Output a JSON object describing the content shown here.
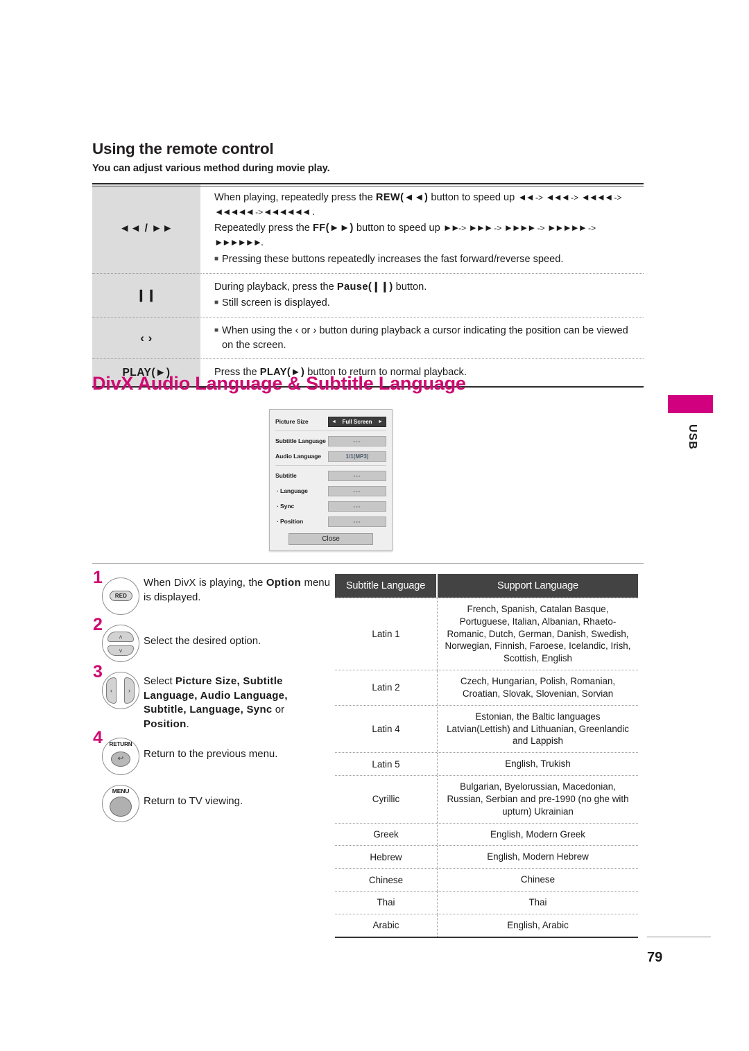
{
  "section": {
    "title": "Using the remote control",
    "subtitle": "You can adjust various method during movie play."
  },
  "remote_table": {
    "rows": [
      {
        "key": "◄◄ / ►►",
        "lines": [
          {
            "type": "text",
            "parts": [
              {
                "t": "When playing, repeatedly press the "
              },
              {
                "t": "REW(◄◄)",
                "bold": true
              },
              {
                "t": " button to speed up "
              },
              {
                "t": "◄◄",
                "arrows": true
              },
              {
                "t": " -> "
              },
              {
                "t": "◄◄◄",
                "arrows": true
              },
              {
                "t": " -> "
              },
              {
                "t": "◄◄◄◄",
                "arrows": true
              },
              {
                "t": " -> "
              },
              {
                "t": "◄◄◄◄◄",
                "arrows": true
              },
              {
                "t": " ->"
              },
              {
                "t": "◄◄◄◄◄◄",
                "arrows": true
              },
              {
                "t": " ."
              }
            ]
          },
          {
            "type": "text",
            "parts": [
              {
                "t": "Repeatedly press the "
              },
              {
                "t": "FF(►►)",
                "bold": true
              },
              {
                "t": " button to speed up "
              },
              {
                "t": "►►",
                "arrows": true
              },
              {
                "t": "-> "
              },
              {
                "t": "►►►",
                "arrows": true
              },
              {
                "t": " -> "
              },
              {
                "t": "►►►►",
                "arrows": true
              },
              {
                "t": " -> "
              },
              {
                "t": "►►►►►",
                "arrows": true
              },
              {
                "t": " -> "
              },
              {
                "t": "►►►►►►",
                "arrows": true
              },
              {
                "t": "."
              }
            ]
          },
          {
            "type": "bullet",
            "parts": [
              {
                "t": "Pressing these buttons repeatedly increases the fast forward/reverse speed."
              }
            ]
          }
        ]
      },
      {
        "key": "❙❙",
        "lines": [
          {
            "type": "text",
            "parts": [
              {
                "t": "During playback, press the "
              },
              {
                "t": "Pause(❙❙)",
                "bold": true
              },
              {
                "t": " button."
              }
            ]
          },
          {
            "type": "bullet",
            "parts": [
              {
                "t": "Still screen is displayed."
              }
            ]
          }
        ]
      },
      {
        "key": "‹  ›",
        "lines": [
          {
            "type": "bullet",
            "parts": [
              {
                "t": "When using the  ‹ or ›  button during playback a cursor indicating the position can be viewed on the screen."
              }
            ]
          }
        ]
      },
      {
        "key": "PLAY(►)",
        "lines": [
          {
            "type": "text",
            "parts": [
              {
                "t": "Press the "
              },
              {
                "t": "PLAY(►)",
                "bold": true
              },
              {
                "t": " button to return to normal playback."
              }
            ]
          }
        ]
      }
    ]
  },
  "divx_heading": "DivX Audio Language & Subtitle Language",
  "osd": {
    "rows": [
      {
        "label": "Picture Size",
        "value": "Full Screen",
        "style": "active",
        "indent": false
      },
      {
        "label": "Subtitle Language",
        "value": "---",
        "style": "dash",
        "indent": false
      },
      {
        "label": "Audio Language",
        "value": "1/1(MP3)",
        "style": "plain",
        "indent": false
      },
      {
        "label": "Subtitle",
        "value": "---",
        "style": "dash",
        "indent": false
      },
      {
        "label": "· Language",
        "value": "---",
        "style": "dash",
        "indent": true
      },
      {
        "label": "· Sync",
        "value": "---",
        "style": "dash",
        "indent": true
      },
      {
        "label": "· Position",
        "value": "---",
        "style": "dash",
        "indent": true
      }
    ],
    "close_label": "Close",
    "left_arrow": "◄",
    "right_arrow": "►"
  },
  "side_tab": {
    "label": "USB",
    "color": "#d1007f"
  },
  "steps": [
    {
      "number": "1",
      "icon": "red-button-icon",
      "button_label": "RED",
      "text_html": "When DivX is playing, the <b>Option</b> menu is displayed."
    },
    {
      "number": "2",
      "icon": "up-down-rocker-icon",
      "up": "˄",
      "down": "˅",
      "text_html": "Select the desired option."
    },
    {
      "number": "3",
      "icon": "left-right-rocker-icon",
      "left": "‹",
      "right": "›",
      "text_html": "Select <b>Picture Size, Subtitle Language, Audio Language, Subtitle, Language, Sync</b> or <b>Position</b>."
    },
    {
      "number": "4",
      "icon": "return-button-icon",
      "button_label": "RETURN",
      "glyph": "↩",
      "text_html": "Return to the previous menu."
    },
    {
      "number": "",
      "icon": "menu-button-icon",
      "button_label": "MENU",
      "text_html": "Return to TV viewing."
    }
  ],
  "language_table": {
    "headers": [
      "Subtitle Language",
      "Support Language"
    ],
    "rows": [
      {
        "subtitle_language": "Latin 1",
        "support_language": "French, Spanish, Catalan Basque, Portuguese, Italian, Albanian, Rhaeto-Romanic, Dutch, German, Danish, Swedish, Norwegian, Finnish, Faroese, Icelandic, Irish, Scottish, English"
      },
      {
        "subtitle_language": "Latin 2",
        "support_language": "Czech, Hungarian, Polish, Romanian, Croatian, Slovak, Slovenian, Sorvian"
      },
      {
        "subtitle_language": "Latin 4",
        "support_language": "Estonian, the Baltic languages Latvian(Lettish) and Lithuanian, Greenlandic and Lappish"
      },
      {
        "subtitle_language": "Latin 5",
        "support_language": "English, Trukish"
      },
      {
        "subtitle_language": "Cyrillic",
        "support_language": "Bulgarian, Byelorussian, Macedonian, Russian, Serbian and pre-1990 (no ghe with upturn) Ukrainian"
      },
      {
        "subtitle_language": "Greek",
        "support_language": "English, Modern Greek"
      },
      {
        "subtitle_language": "Hebrew",
        "support_language": "English, Modern Hebrew"
      },
      {
        "subtitle_language": "Chinese",
        "support_language": "Chinese"
      },
      {
        "subtitle_language": "Thai",
        "support_language": "Thai"
      },
      {
        "subtitle_language": "Arabic",
        "support_language": "English, Arabic"
      }
    ]
  },
  "footer": {
    "page_number": "79"
  }
}
